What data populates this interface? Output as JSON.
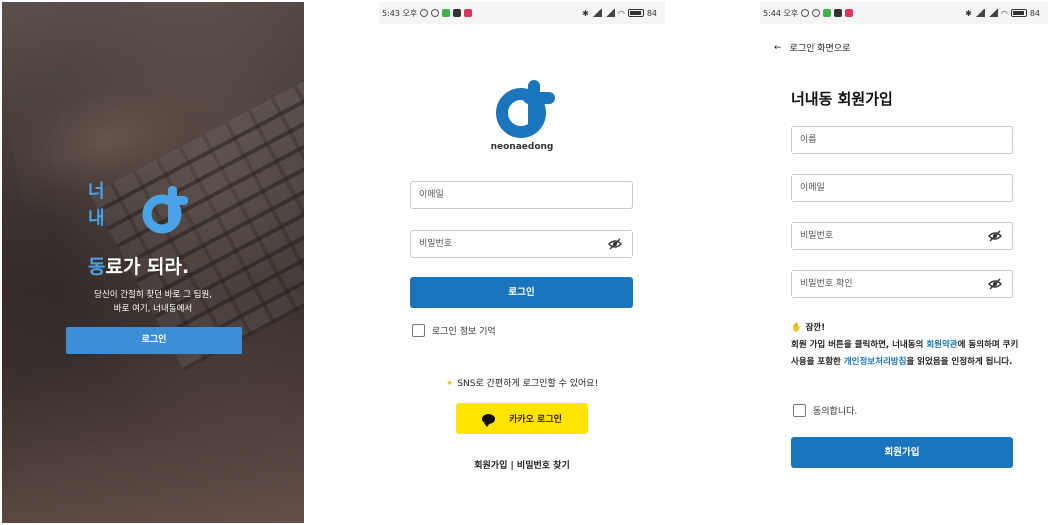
{
  "colors": {
    "primary": "#1a75bd",
    "splash_button": "#3a8fd6",
    "accent": "#4aa3e6",
    "kakao": "#fee500"
  },
  "splash": {
    "syllable_1": "너",
    "syllable_2": "내",
    "tagline_accent": "동",
    "tagline_rest": "료가 되라.",
    "subtitle_line1": "당신이 간절히 찾던 바로 그 팀원,",
    "subtitle_line2": "바로 여기, 너내동에서",
    "login_button": "로그인"
  },
  "login_screen": {
    "status": {
      "time": "5:43 오후",
      "battery": "84"
    },
    "brand": "neonaedong",
    "email_placeholder": "이메일",
    "password_placeholder": "비밀번호",
    "login_button": "로그인",
    "remember_label": "로그인 정보 기억",
    "sns_text": "SNS로 간편하게 로그인할 수 있어요!",
    "kakao_button": "카카오 로그인",
    "links": "회원가입 | 비밀번호 찾기"
  },
  "signup_screen": {
    "status": {
      "time": "5:44 오후",
      "battery": "84"
    },
    "back_label": "로그인 화면으로",
    "title": "너내동 회원가입",
    "name_placeholder": "이름",
    "email_placeholder": "이메일",
    "password_placeholder": "비밀번호",
    "password_confirm_placeholder": "비밀번호 확인",
    "notice_title": "잠깐!",
    "notice_part1": "회원 가입 버튼을 클릭하면, 너내동의 ",
    "notice_link1": "회원약관",
    "notice_part2": "에 동의하며 쿠키 사용을 포함한 ",
    "notice_link2": "개인정보처리방침",
    "notice_part3": "을 읽었음을 인정하게 됩니다.",
    "agree_label": "동의합니다.",
    "join_button": "회원가입"
  }
}
